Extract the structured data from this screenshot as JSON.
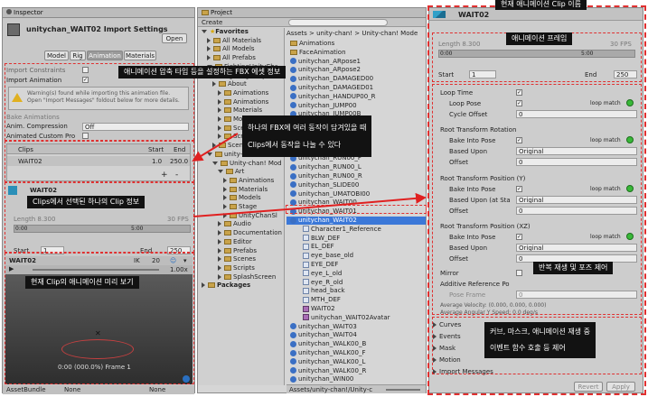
{
  "inspector": {
    "tab": "Inspector",
    "title": "unitychan_WAIT02 Import Settings",
    "open_label": "Open",
    "tabs": [
      "Model",
      "Rig",
      "Animation",
      "Materials"
    ],
    "import_constraints": "Import Constraints",
    "import_animation": "Import Animation",
    "warning": "Warning(s) found while importing this animation file. Open \"Import Messages\" foldout below for more details.",
    "bake_animations": "Bake Animations",
    "anim_compression": "Anim. Compression",
    "anim_compression_value": "Off",
    "animated_custom": "Animated Custom Pro",
    "clips_header": "Clips",
    "start_header": "Start",
    "end_header": "End",
    "clip_name": "WAIT02",
    "clip_start": "1.0",
    "clip_end": "250.0",
    "plus": "+",
    "minus": "-",
    "clip_title": "WAIT02",
    "length_label": "Length 8.300",
    "fps_label": "30 FPS",
    "tick_0": "0:00",
    "tick_1": "5:00",
    "start_label": "Start",
    "start_value": "1",
    "end_label": "End",
    "end_value": "250",
    "preview_title": "WAIT02",
    "preview_ik": "IK",
    "preview_num": "20",
    "preview_speed": "1.00x",
    "preview_time": "0:00 (000.0%) Frame 1",
    "assetbundle_label": "AssetBundle",
    "assetbundle_value": "None",
    "assetbundle_variant": "None"
  },
  "project": {
    "tab": "Project",
    "create": "Create",
    "path": "Assets > unity-chan! > Unity-chan! Mode",
    "tree": [
      "Favorites",
      "All Materials",
      "All Models",
      "All Prefabs",
      "FightingUnityCha",
      "FightingUnityCha",
      "About",
      "Animations",
      "Animations",
      "Materials",
      "Models",
      "Scenes",
      "Scripts",
      "Scenes",
      "unity-chan!",
      "Unity-chan! Mod",
      "Art",
      "Animations",
      "Materials",
      "Models",
      "Stage",
      "UnityChanSl",
      "Audio",
      "Documentation",
      "Editor",
      "Prefabs",
      "Scenes",
      "Scripts",
      "SplashScreen",
      "Packages"
    ],
    "files": [
      "Animations",
      "FaceAnimation",
      "unitychan_ARpose1",
      "unitychan_ARpose2",
      "unitychan_DAMAGED00",
      "unitychan_DAMAGED01",
      "unitychan_HANDUP00_R",
      "unitychan_JUMP00",
      "unitychan_JUMP00B",
      "unitychan_JUMP01",
      "unitychan_JUMP01B",
      "unitychan_LOSE00",
      "unitychan_REFLESH00",
      "unitychan_RUN00_F",
      "unitychan_RUN00_L",
      "unitychan_RUN00_R",
      "unitychan_SLIDE00",
      "unitychan_UMATOBI00",
      "unitychan_WAIT00",
      "unitychan_WAIT01",
      "unitychan_WAIT02",
      "Character1_Reference",
      "BLW_DEF",
      "EL_DEF",
      "eye_base_old",
      "EYE_DEF",
      "eye_L_old",
      "eye_R_old",
      "head_back",
      "MTH_DEF",
      "WAIT02",
      "unitychan_WAIT02Avatar",
      "unitychan_WAIT03",
      "unitychan_WAIT04",
      "unitychan_WALK00_B",
      "unitychan_WALK00_F",
      "unitychan_WALK00_L",
      "unitychan_WALK00_R",
      "unitychan_WIN00"
    ],
    "footer": "Assets/unity-chan!/Unity-c"
  },
  "right": {
    "title": "WAIT02",
    "length_label": "Length 8.300",
    "fps_label": "30 FPS",
    "tick_0": "0:00",
    "tick_1": "5:00",
    "start_label": "Start",
    "start_value": "1",
    "end_label": "End",
    "end_value": "250",
    "loop_time": "Loop Time",
    "loop_pose": "Loop Pose",
    "loop_match": "loop match",
    "cycle_offset": "Cycle Offset",
    "cycle_offset_value": "0",
    "rot_header": "Root Transform Rotation",
    "bake_into_pose": "Bake Into Pose",
    "based_upon": "Based Upon",
    "original": "Original",
    "offset": "Offset",
    "offset_value": "0",
    "posy_header": "Root Transform Position (Y)",
    "based_upon_start": "Based Upon (at Sta",
    "posxz_header": "Root Transform Position (XZ)",
    "mirror": "Mirror",
    "additive": "Additive Reference Po",
    "pose_frame": "Pose Frame",
    "pose_frame_value": "0",
    "avg_vel": "Average Velocity: (0.000, 0.000, 0.000)",
    "avg_ang": "Average Angular Y Speed: 0.0 deg/s",
    "foldouts": [
      "Curves",
      "Events",
      "Mask",
      "Motion",
      "Import Messages"
    ],
    "revert": "Revert",
    "apply": "Apply"
  },
  "annotations": {
    "top": "현재 애니메이션 Clip 이름",
    "fbx": "애니메이션 압축 타입 등을 설정하는 FBX 에셋 정보",
    "multi1": "하나의 FBX에 여러 동작이 담겨있을 때",
    "multi2": "Clips에서 동작을 나눌 수 있다",
    "clipinfo": "Clips에서 선택된 하나의 Clip 정보",
    "preview": "현재 Clip의 애니메이션 미리 보기",
    "frame": "애니메이션 프레임",
    "loop": "반복 재생 및 포즈 제어",
    "etc1": "커브, 마스크, 애니메이션 재생 중",
    "etc2": "이벤트 함수 호출 등 제어"
  }
}
